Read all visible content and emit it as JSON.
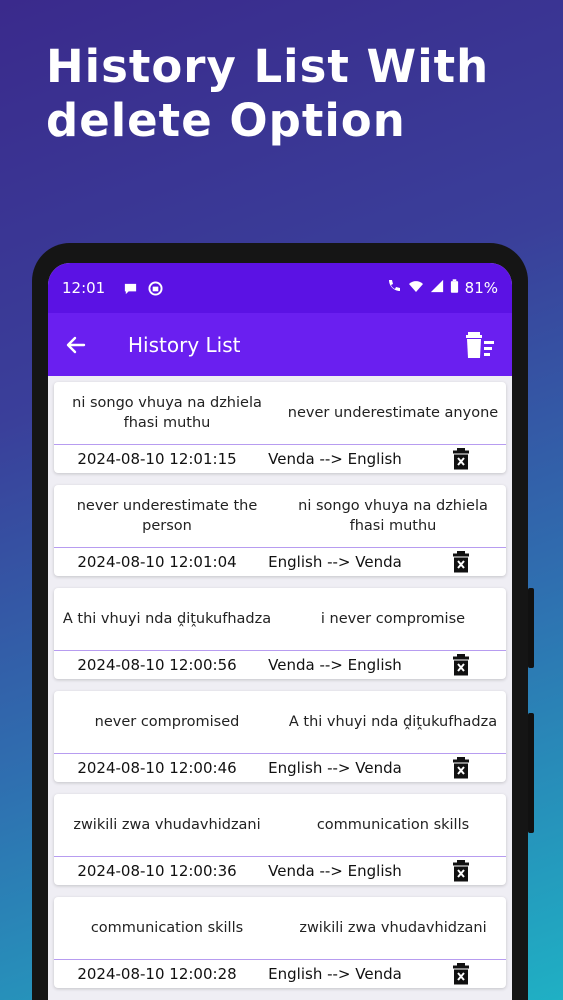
{
  "promo": {
    "headline": "History List With delete Option"
  },
  "status_bar": {
    "time": "12:01",
    "battery": "81%"
  },
  "app_bar": {
    "title": "History List"
  },
  "history": [
    {
      "source": "ni songo vhuya na dzhiela fhasi muthu",
      "target": "never underestimate anyone",
      "timestamp": "2024-08-10 12:01:15",
      "direction": "Venda --> English"
    },
    {
      "source": "never underestimate the person",
      "target": "ni songo vhuya na dzhiela fhasi muthu",
      "timestamp": "2024-08-10 12:01:04",
      "direction": "English --> Venda"
    },
    {
      "source": "A thi vhuyi nda ḓiṱukufhadza",
      "target": "i never compromise",
      "timestamp": "2024-08-10 12:00:56",
      "direction": "Venda --> English"
    },
    {
      "source": "never compromised",
      "target": "A thi vhuyi nda ḓiṱukufhadza",
      "timestamp": "2024-08-10 12:00:46",
      "direction": "English --> Venda"
    },
    {
      "source": "zwikili zwa vhudavhidzani",
      "target": "communication skills",
      "timestamp": "2024-08-10 12:00:36",
      "direction": "Venda --> English"
    },
    {
      "source": "communication skills",
      "target": "zwikili zwa vhudavhidzani",
      "timestamp": "2024-08-10 12:00:28",
      "direction": "English --> Venda"
    }
  ],
  "colors": {
    "status_bar": "#5b12e4",
    "app_bar": "#6a1ff0",
    "divider": "#b79cf0"
  },
  "icons": {
    "back": "arrow-left-icon",
    "clear_all": "clear-all-icon",
    "delete": "delete-icon"
  }
}
